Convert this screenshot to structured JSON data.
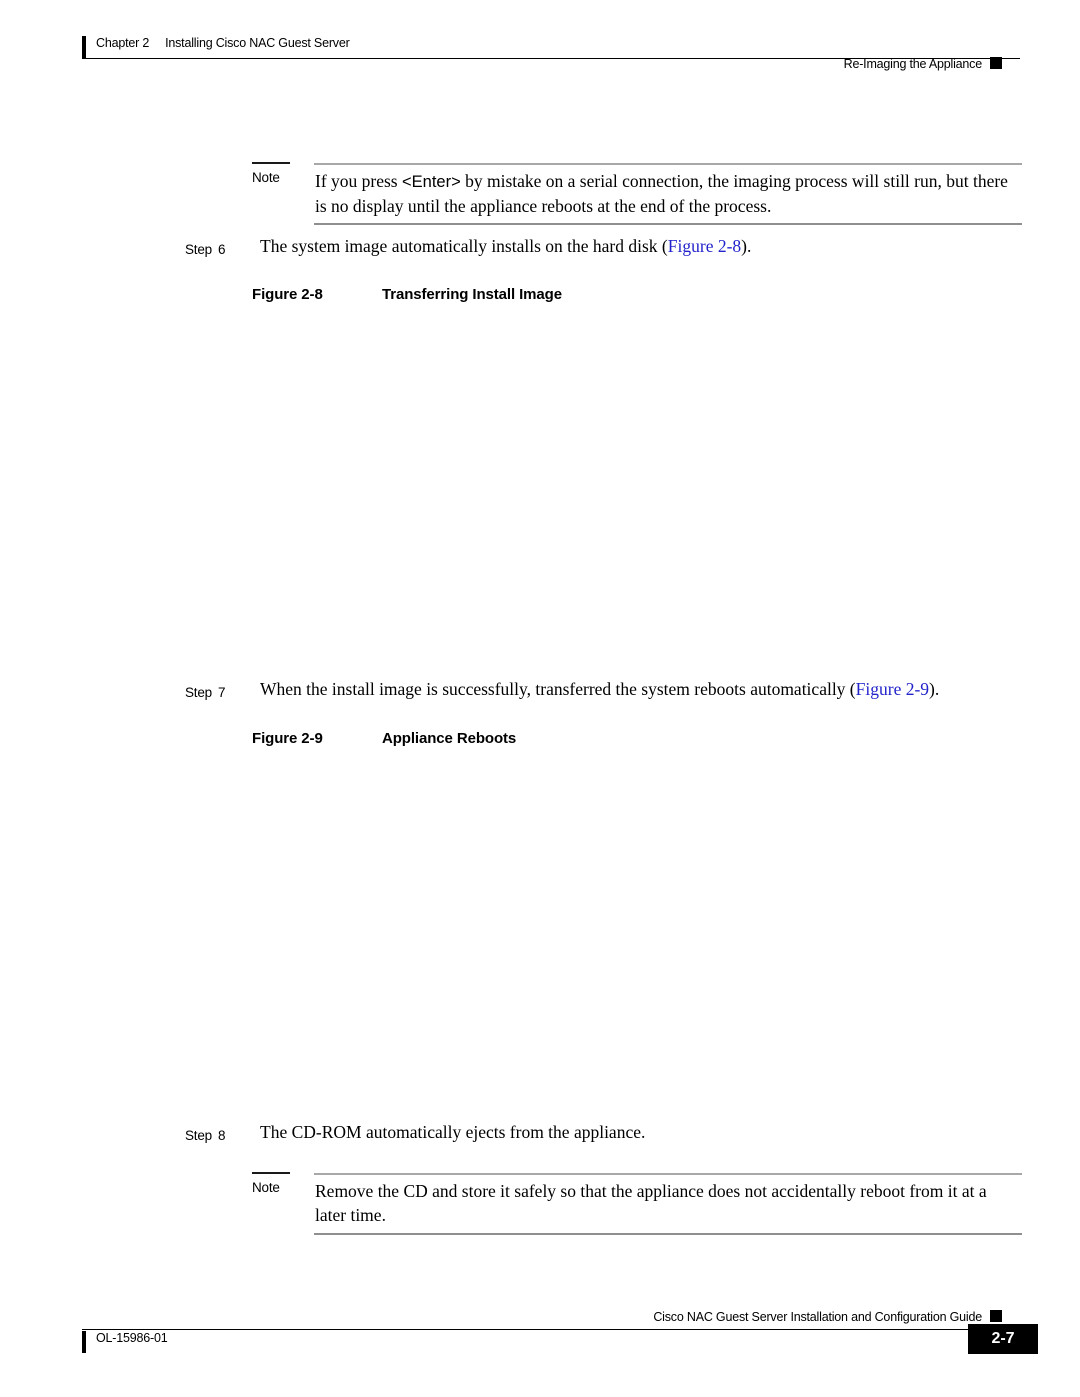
{
  "document": {
    "title": "Cisco NAC Guest Server Installation and Configuration Guide",
    "doc_number": "OL-15986-01",
    "page_number": "2-7"
  },
  "header": {
    "chapter_label": "Chapter 2",
    "chapter_title": "Installing Cisco NAC Guest Server",
    "section_title": "Re-Imaging the Appliance"
  },
  "notes": [
    {
      "label": "Note",
      "text_line1": "If you press ",
      "keycap": "<Enter>",
      "text_line2": " by mistake on a serial connection, the imaging process will still run, but there is no display until the appliance reboots at the end of the process."
    },
    {
      "label": "Note",
      "text": "Remove the CD and store it safely so that the appliance does not accidentally reboot from it at a later time."
    }
  ],
  "steps": [
    {
      "label": "Step",
      "number": "6",
      "text_before": "The system image automatically installs on the hard disk (",
      "xref": "Figure 2-8",
      "text_after": ")."
    },
    {
      "label": "Step",
      "number": "7",
      "text_before": "When the install image is successfully, transferred the system reboots automatically (",
      "xref": "Figure 2-9",
      "text_after": ")."
    },
    {
      "label": "Step",
      "number": "8",
      "text_before": "The CD-ROM automatically ejects from the appliance.",
      "xref": "",
      "text_after": ""
    }
  ],
  "figures": [
    {
      "number": "Figure 2-8",
      "caption": "Transferring Install Image"
    },
    {
      "number": "Figure 2-9",
      "caption": "Appliance Reboots"
    }
  ],
  "colors": {
    "xref_blue": "#2222cc",
    "rule_black": "#000000",
    "note_rule_gray": "#a8a8a8"
  }
}
